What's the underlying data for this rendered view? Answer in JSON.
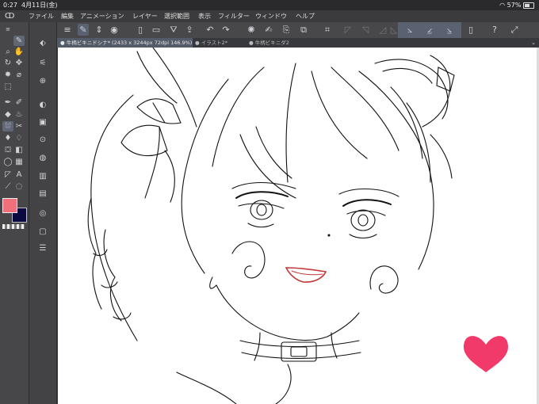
{
  "status": {
    "time": "0:27",
    "date": "4月11日(金)",
    "battery": "57%",
    "wifi_icon": "wifi-icon"
  },
  "menu": [
    "ファイル",
    "編集",
    "アニメーション",
    "レイヤー",
    "選択範囲",
    "表示",
    "フィルター",
    "ウィンドウ",
    "ヘルプ"
  ],
  "tabs": [
    {
      "label": "● 牛柄ビキニドシナ* (2433 x 3244px 72dpi 146.9%)"
    },
    {
      "label": "● イラスト2*"
    },
    {
      "label": "● 牛柄ビキニダ2"
    }
  ],
  "colors": {
    "main": "#ef6f7a",
    "sub": "#0b0a40",
    "heart": "#f23a6a",
    "mouth": "#c43a3a"
  }
}
